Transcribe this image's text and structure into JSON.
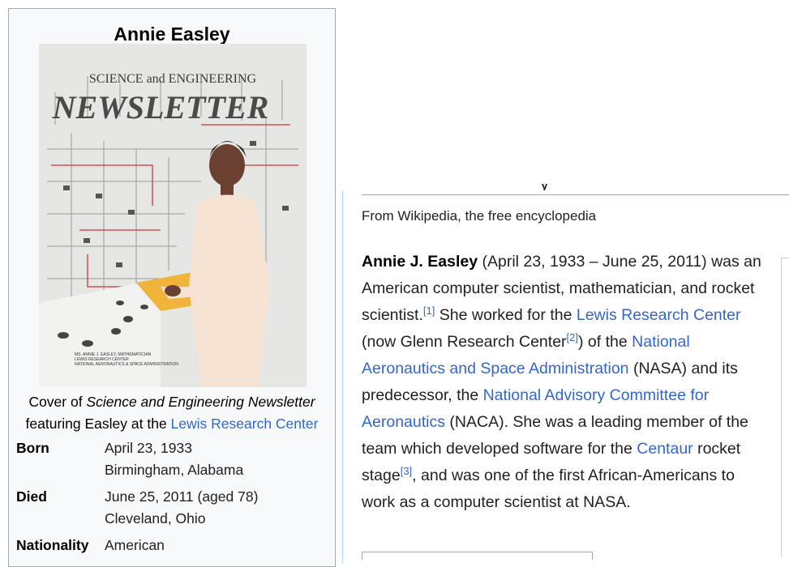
{
  "infobox": {
    "title": "Annie Easley",
    "cover": {
      "line1": "SCIENCE and ENGINEERING",
      "line2": "NEWSLETTER",
      "small1": "MS. ANNIE J. EASLEY, MATHEMATICIAN",
      "small2": "LEWIS RESEARCH CENTER",
      "small3": "NATIONAL AERONAUTICS & SPACE ADMINISTRATION"
    },
    "caption": {
      "part1": "Cover of ",
      "italic": "Science and Engineering Newsletter",
      "part2": "featuring Easley at the ",
      "link": "Lewis Research Center"
    },
    "born": {
      "label": "Born",
      "date": "April 23, 1933",
      "place": "Birmingham, Alabama"
    },
    "died": {
      "label": "Died",
      "date": "June 25, 2011 (aged 78)",
      "place": "Cleveland, Ohio"
    },
    "nationality": {
      "label": "Nationality",
      "value": "American"
    }
  },
  "article": {
    "tagline": "From Wikipedia, the free encyclopedia",
    "lead": {
      "name": "Annie J. Easley",
      "t1": " (April 23, 1933 – June 25, 2011) was an American computer scientist, mathematician, and rocket scientist.",
      "ref1": "[1]",
      "t2": " She worked for the ",
      "link1": "Lewis Research Center",
      "t3": " (now Glenn Research Center",
      "ref2": "[2]",
      "t4": ") of the ",
      "link2": "National Aeronautics and Space Administration",
      "t5": " (NASA) and its predecessor, the ",
      "link3": "National Advisory Committee for Aeronautics",
      "t6": " (NACA). She was a leading member of the team which developed software for the ",
      "link4": "Centaur",
      "t7": " rocket stage",
      "ref3": "[3]",
      "t8": ", and was one of the first African-Americans to work as a computer scientist at NASA."
    }
  }
}
